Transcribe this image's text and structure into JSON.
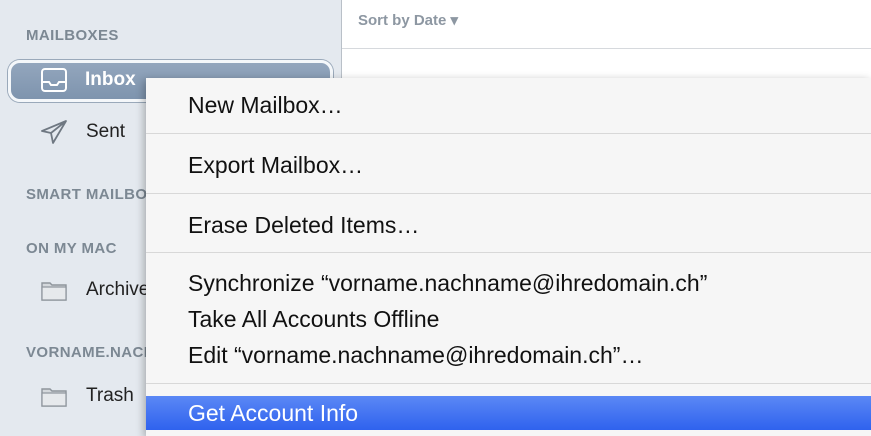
{
  "sidebar": {
    "mailboxes_header": "MAILBOXES",
    "smart_header": "SMART MAILBOXES",
    "onmymac_header": "ON MY MAC",
    "account_header": "VORNAME.NACHNAME",
    "items": [
      {
        "label": "Inbox",
        "icon": "inbox-icon"
      },
      {
        "label": "Sent",
        "icon": "paper-plane-icon"
      },
      {
        "label": "Archive",
        "icon": "folder-icon"
      },
      {
        "label": "Trash",
        "icon": "folder-icon"
      }
    ]
  },
  "list_header": {
    "sort_label": "Sort by Date ▾"
  },
  "menu": {
    "items": [
      "New Mailbox…",
      "Export Mailbox…",
      "Erase Deleted Items…",
      "Synchronize “vorname.nachname@ihredomain.ch”",
      "Take All Accounts Offline",
      "Edit “vorname.nachname@ihredomain.ch”…",
      "Get Account Info"
    ]
  },
  "colors": {
    "highlight": "#3a6ff0",
    "sidebar": "#e4e9ef",
    "selected": "#8599b2"
  }
}
